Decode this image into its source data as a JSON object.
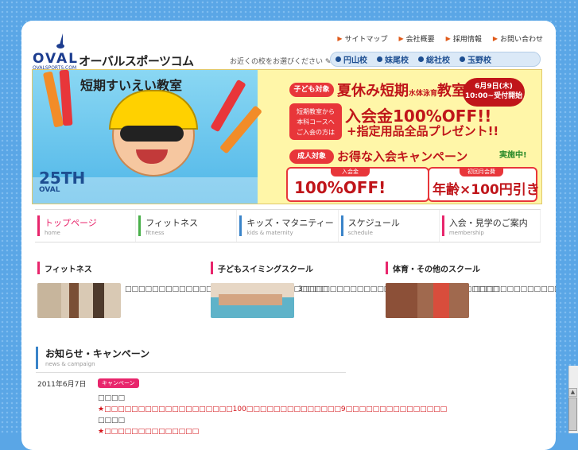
{
  "logo": {
    "oval": "OVAL",
    "sub": "OVALSPORTS.COM"
  },
  "brand": "オーバルスポーツコム",
  "topnav": [
    {
      "label": "サイトマップ"
    },
    {
      "label": "会社概要"
    },
    {
      "label": "採用情報"
    },
    {
      "label": "お問い合わせ"
    }
  ],
  "finder": {
    "label": "お近くの校をお選びください",
    "schools": [
      "円山校",
      "妹尾校",
      "総社校",
      "玉野校"
    ]
  },
  "banner": {
    "left_title": "短期すいえい教室",
    "anniv": "25TH",
    "anniv_brand": "OVAL",
    "kids_pill": "子ども対象",
    "summer": "夏休み短期",
    "summer_small": "水体泳育",
    "summer_class": "教室",
    "date": "6月9日(木)",
    "date_sub": "10:00~受付開始",
    "short_note_1": "短期教室から",
    "short_note_2": "本科コースへ",
    "short_note_3": "ご入会の方は",
    "fee_off": "入会金100%OFF!!",
    "gift": "+指定用品全品プレゼント!!",
    "adult_pill": "成人対象",
    "campaign": "お得な入会キャンペーン",
    "now": "実施中!",
    "box1_label": "入会金",
    "box1_big": "100%OFF!",
    "box2_label": "初回月会費",
    "box2_big": "年齢×100円引き!"
  },
  "gnav": [
    {
      "jp": "トップページ",
      "en": "home",
      "color": "#e8266c"
    },
    {
      "jp": "フィットネス",
      "en": "fitness",
      "color": "#49b04a"
    },
    {
      "jp": "キッズ・マタニティー",
      "en": "kids & maternity",
      "color": "#3a84c9"
    },
    {
      "jp": "スケジュール",
      "en": "schedule",
      "color": "#3a84c9"
    },
    {
      "jp": "入会・見学のご案内",
      "en": "membership",
      "color": "#e8266c"
    }
  ],
  "categories": [
    {
      "title": "フィットネス",
      "color": "#e8266c",
      "text": "□□□□□□□□□□□□□□□□□□□□□□□□□□□□□□"
    },
    {
      "title": "子どもスイミングスクール",
      "color": "#e8266c",
      "text": "3□□□□□□□□□□□□□□□□□□□□□□□□□□□□□"
    },
    {
      "title": "体育・その他のスクール",
      "color": "#e8266c",
      "text": "□□□□□□□□□□□□□□□□□□□□□□□□□□□□□□□□"
    }
  ],
  "news": {
    "title": "お知らせ・キャンペーン",
    "sub": "news & campaign",
    "date": "2011年6月7日",
    "badge": "キャンペーン",
    "line1": "□□□□",
    "line2": "★□□□□□□□□□□□□□□□□□□□100□□□□□□□□□□□□□□9□□□□□□□□□□□□□□□",
    "line3": "□□□□",
    "line4": "★□□□□□□□□□□□□□□"
  }
}
